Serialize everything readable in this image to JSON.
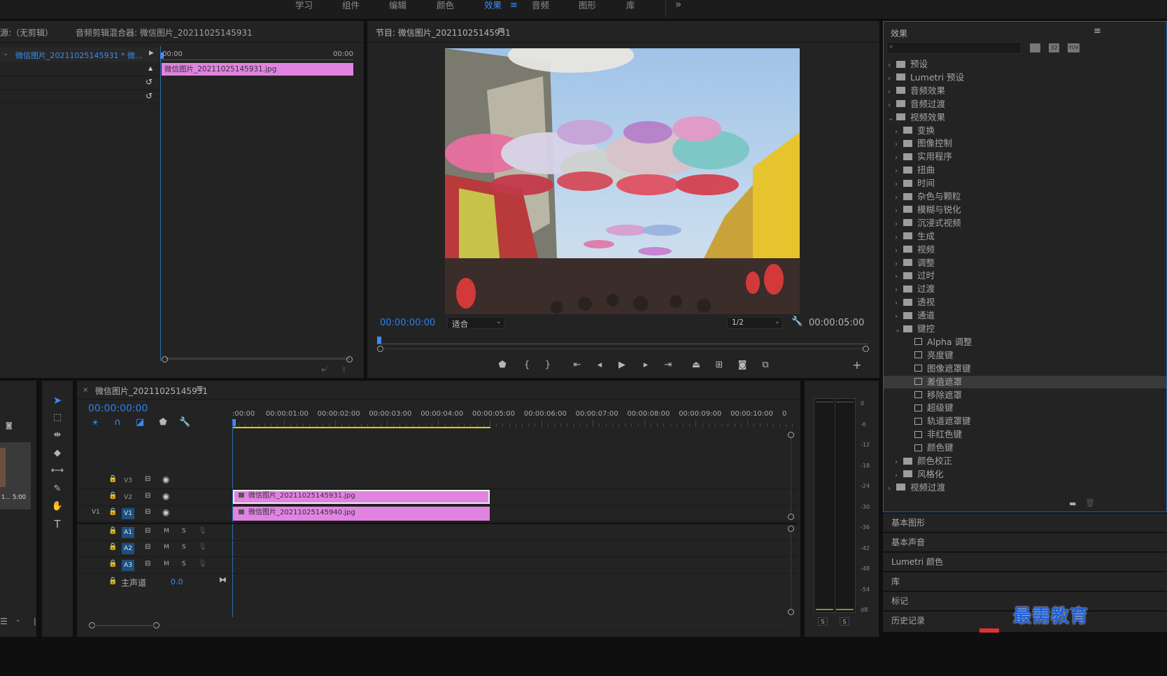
{
  "workspaces": [
    {
      "label": "学习",
      "active": false
    },
    {
      "label": "组件",
      "active": false
    },
    {
      "label": "编辑",
      "active": false
    },
    {
      "label": "颜色",
      "active": false
    },
    {
      "label": "效果",
      "active": true
    },
    {
      "label": "音频",
      "active": false
    },
    {
      "label": "图形",
      "active": false
    },
    {
      "label": "库",
      "active": false
    }
  ],
  "workspace_menu_icon": "≡",
  "workspace_overflow": "»",
  "source_panel": {
    "tab_source": "源:（无剪辑）",
    "tab_mixer": "音频剪辑混合器: 微信图片_20211025145931",
    "clip_label": "微信图片_20211025145931 * 微...",
    "time_start": "00:00",
    "time_end": "00:00",
    "clip_name": "微信图片_20211025145931.jpg"
  },
  "program": {
    "title": "节目: 微信图片_20211025145931",
    "timecode": "00:00:00:00",
    "fit": "适合",
    "quality": "1/2",
    "duration": "00:00:05:00"
  },
  "effects": {
    "title": "效果",
    "search_placeholder": "",
    "badges": [
      "32",
      "YUV"
    ],
    "tree": [
      {
        "label": "预设",
        "level": 0,
        "type": "folder",
        "open": false
      },
      {
        "label": "Lumetri 预设",
        "level": 0,
        "type": "folder",
        "open": false
      },
      {
        "label": "音频效果",
        "level": 0,
        "type": "folder",
        "open": false
      },
      {
        "label": "音频过渡",
        "level": 0,
        "type": "folder",
        "open": false
      },
      {
        "label": "视频效果",
        "level": 0,
        "type": "folder",
        "open": true
      },
      {
        "label": "变换",
        "level": 1,
        "type": "folder",
        "open": false
      },
      {
        "label": "图像控制",
        "level": 1,
        "type": "folder",
        "open": false
      },
      {
        "label": "实用程序",
        "level": 1,
        "type": "folder",
        "open": false
      },
      {
        "label": "扭曲",
        "level": 1,
        "type": "folder",
        "open": false
      },
      {
        "label": "时间",
        "level": 1,
        "type": "folder",
        "open": false
      },
      {
        "label": "杂色与颗粒",
        "level": 1,
        "type": "folder",
        "open": false
      },
      {
        "label": "模糊与锐化",
        "level": 1,
        "type": "folder",
        "open": false
      },
      {
        "label": "沉浸式视频",
        "level": 1,
        "type": "folder",
        "open": false
      },
      {
        "label": "生成",
        "level": 1,
        "type": "folder",
        "open": false
      },
      {
        "label": "视频",
        "level": 1,
        "type": "folder",
        "open": false
      },
      {
        "label": "调整",
        "level": 1,
        "type": "folder",
        "open": false
      },
      {
        "label": "过时",
        "level": 1,
        "type": "folder",
        "open": false
      },
      {
        "label": "过渡",
        "level": 1,
        "type": "folder",
        "open": false
      },
      {
        "label": "透视",
        "level": 1,
        "type": "folder",
        "open": false
      },
      {
        "label": "通道",
        "level": 1,
        "type": "folder",
        "open": false
      },
      {
        "label": "键控",
        "level": 1,
        "type": "folder",
        "open": true
      },
      {
        "label": "Alpha 调整",
        "level": 2,
        "type": "effect"
      },
      {
        "label": "亮度键",
        "level": 2,
        "type": "effect"
      },
      {
        "label": "图像遮罩键",
        "level": 2,
        "type": "effect"
      },
      {
        "label": "差值遮罩",
        "level": 2,
        "type": "effect",
        "selected": true
      },
      {
        "label": "移除遮罩",
        "level": 2,
        "type": "effect"
      },
      {
        "label": "超级键",
        "level": 2,
        "type": "effect"
      },
      {
        "label": "轨道遮罩键",
        "level": 2,
        "type": "effect"
      },
      {
        "label": "非红色键",
        "level": 2,
        "type": "effect"
      },
      {
        "label": "颜色键",
        "level": 2,
        "type": "effect"
      },
      {
        "label": "颜色校正",
        "level": 1,
        "type": "folder",
        "open": false
      },
      {
        "label": "风格化",
        "level": 1,
        "type": "folder",
        "open": false
      },
      {
        "label": "视频过渡",
        "level": 0,
        "type": "folder",
        "open": false
      }
    ]
  },
  "side_sections": [
    "基本图形",
    "基本声音",
    "Lumetri 颜色",
    "库",
    "标记",
    "历史记录"
  ],
  "timeline": {
    "title": "微信图片_20211025145931",
    "timecode": "00:00:00:00",
    "ruler": [
      ":00:00",
      "00:00:01:00",
      "00:00:02:00",
      "00:00:03:00",
      "00:00:04:00",
      "00:00:05:00",
      "00:00:06:00",
      "00:00:07:00",
      "00:00:08:00",
      "00:00:09:00",
      "00:00:10:00",
      "0"
    ],
    "video_tracks": [
      "V3",
      "V2",
      "V1"
    ],
    "source_patch": "V1",
    "audio_tracks": [
      "A1",
      "A2",
      "A3"
    ],
    "mute_label": "M",
    "solo_label": "S",
    "master_label": "主声道",
    "master_value": "0.0",
    "clip_v2": "微信图片_20211025145931.jpg",
    "clip_v1": "微信图片_20211025145940.jpg"
  },
  "project_thumb_label": "5:00",
  "project_thumb_prefix": "1...",
  "meter_scale": [
    "0",
    "-6",
    "-12",
    "-18",
    "-24",
    "-30",
    "-36",
    "-42",
    "-48",
    "-54",
    "dB"
  ],
  "meter_solo": [
    "S",
    "S"
  ],
  "watermark": "最需教育"
}
